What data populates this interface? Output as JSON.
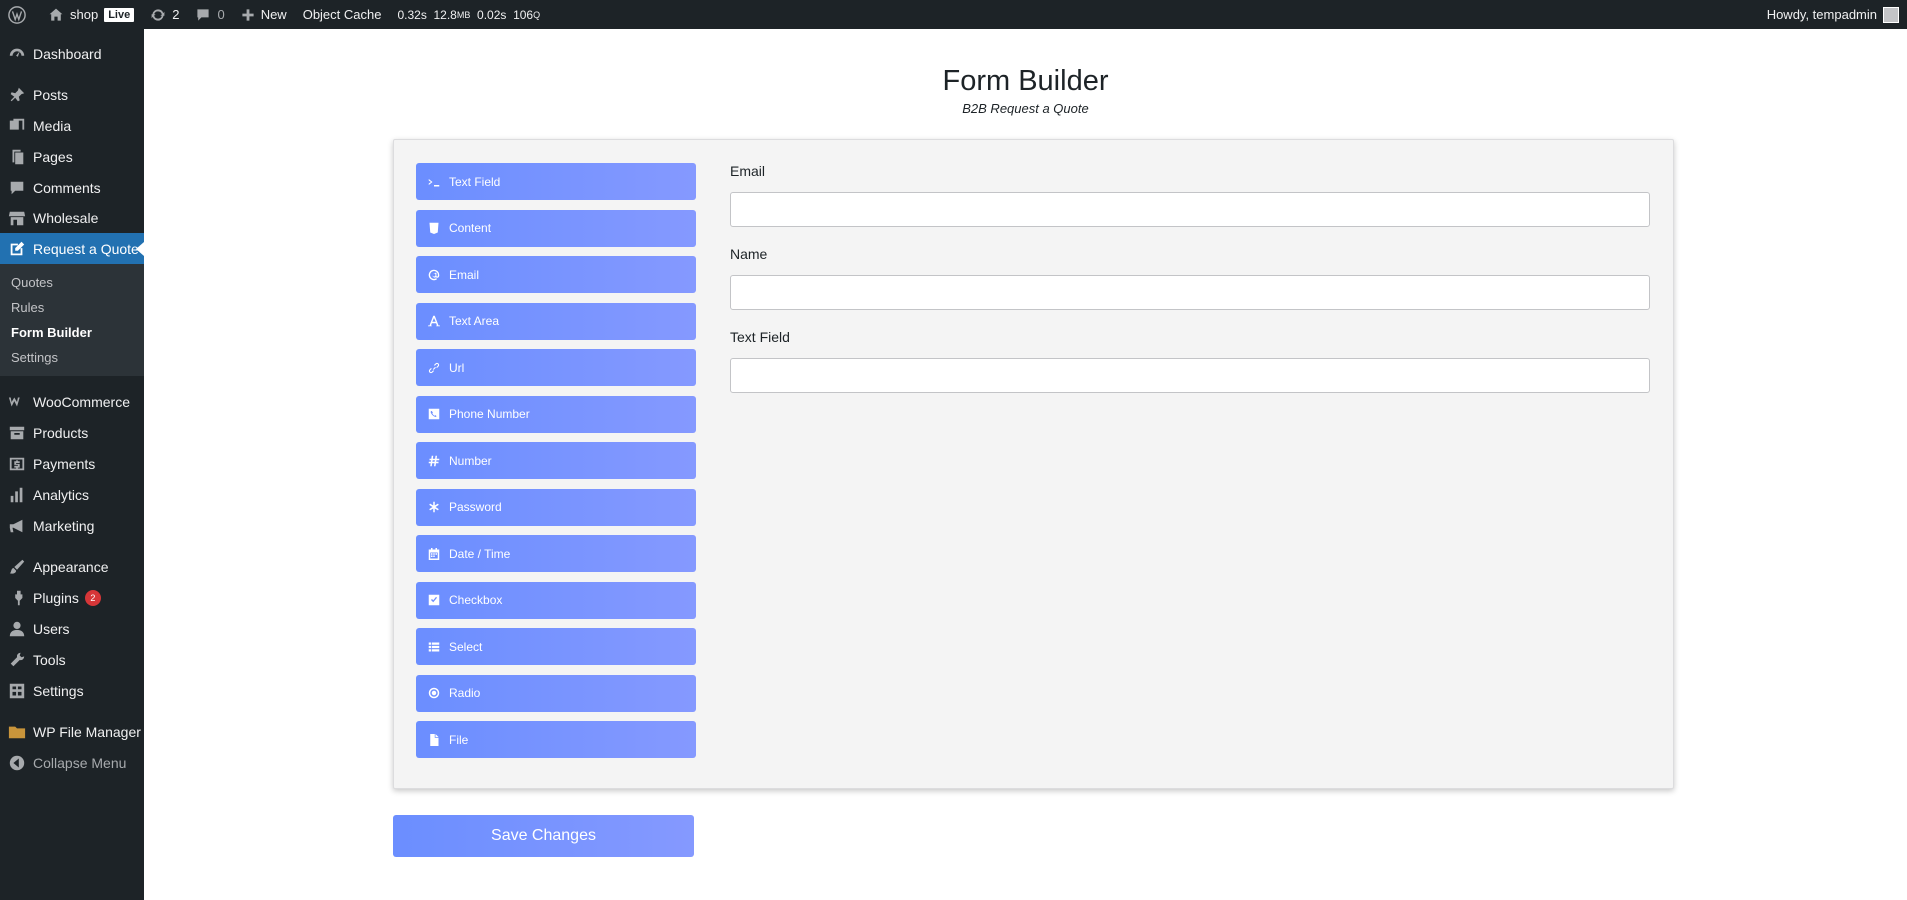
{
  "adminbar": {
    "site_name": "shop",
    "live_label": "Live",
    "updates_count": "2",
    "comments_count": "0",
    "new_label": "New",
    "object_cache_label": "Object Cache",
    "qm_time": "0.32s",
    "qm_memory": "12.8",
    "qm_memory_unit": "MB",
    "qm_db_time": "0.02s",
    "qm_queries": "106",
    "qm_queries_unit": "Q",
    "howdy": "Howdy, tempadmin"
  },
  "sidebar": {
    "items": [
      {
        "label": "Dashboard",
        "icon": "dashboard-icon"
      },
      {
        "label": "Posts",
        "icon": "pin-icon"
      },
      {
        "label": "Media",
        "icon": "media-icon"
      },
      {
        "label": "Pages",
        "icon": "pages-icon"
      },
      {
        "label": "Comments",
        "icon": "comment-icon"
      },
      {
        "label": "Wholesale",
        "icon": "store-icon"
      },
      {
        "label": "Request a Quote",
        "icon": "edit-icon"
      },
      {
        "label": "WooCommerce",
        "icon": "woo-icon"
      },
      {
        "label": "Products",
        "icon": "archive-icon"
      },
      {
        "label": "Payments",
        "icon": "money-icon"
      },
      {
        "label": "Analytics",
        "icon": "chart-bar-icon"
      },
      {
        "label": "Marketing",
        "icon": "megaphone-icon"
      },
      {
        "label": "Appearance",
        "icon": "brush-icon"
      },
      {
        "label": "Plugins",
        "icon": "plugin-icon",
        "badge": "2"
      },
      {
        "label": "Users",
        "icon": "user-icon"
      },
      {
        "label": "Tools",
        "icon": "wrench-icon"
      },
      {
        "label": "Settings",
        "icon": "settings-icon"
      },
      {
        "label": "WP File Manager",
        "icon": "folder-icon"
      },
      {
        "label": "Collapse Menu",
        "icon": "collapse-icon"
      }
    ],
    "submenu": [
      "Quotes",
      "Rules",
      "Form Builder",
      "Settings"
    ]
  },
  "page": {
    "title": "Form Builder",
    "subtitle": "B2B Request a Quote"
  },
  "fields": [
    {
      "label": "Text Field",
      "icon": "terminal-icon"
    },
    {
      "label": "Content",
      "icon": "html-icon"
    },
    {
      "label": "Email",
      "icon": "at-icon"
    },
    {
      "label": "Text Area",
      "icon": "font-icon"
    },
    {
      "label": "Url",
      "icon": "link-icon"
    },
    {
      "label": "Phone Number",
      "icon": "phone-icon"
    },
    {
      "label": "Number",
      "icon": "hash-icon"
    },
    {
      "label": "Password",
      "icon": "asterisk-icon"
    },
    {
      "label": "Date / Time",
      "icon": "calendar-icon"
    },
    {
      "label": "Checkbox",
      "icon": "checkbox-icon"
    },
    {
      "label": "Select",
      "icon": "list-icon"
    },
    {
      "label": "Radio",
      "icon": "radio-icon"
    },
    {
      "label": "File",
      "icon": "file-icon"
    }
  ],
  "form": {
    "fields": [
      {
        "label": "Email",
        "value": ""
      },
      {
        "label": "Name",
        "value": ""
      },
      {
        "label": "Text Field",
        "value": ""
      }
    ]
  },
  "save_label": "Save Changes",
  "colors": {
    "admin_dark": "#1d2327",
    "admin_blue": "#2271b1",
    "button_gradient_start": "#6b8eff",
    "button_gradient_end": "#8599ff"
  }
}
